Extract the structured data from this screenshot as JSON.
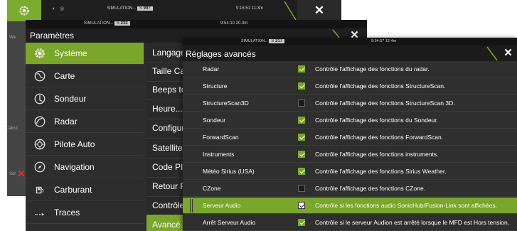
{
  "colors": {
    "accent": "#7aa62b",
    "window": "#2f2f2f",
    "close_x": "#ffffff",
    "alert_x": "#d9322f"
  },
  "window1": {
    "status_sim": "SIMULATION...",
    "status_badge": "S",
    "status_value": "907",
    "status_time": "9:16:51  11.3m",
    "close_label": "✕",
    "left_text_1": "Wa",
    "left_text_2": "Calcul",
    "left_text_3": "Sol",
    "alert_label": "✕"
  },
  "window2": {
    "status_sim": "SIMULATION...",
    "status_badge": "S",
    "status_value": "232",
    "status_time": "9:54:10  20.3m",
    "title": "Paramètres",
    "close_label": "✕",
    "menu": [
      {
        "label": "Système",
        "icon": "gear-icon"
      },
      {
        "label": "Carte",
        "icon": "globe-icon"
      },
      {
        "label": "Sondeur",
        "icon": "sonar-icon"
      },
      {
        "label": "Radar",
        "icon": "radar-icon"
      },
      {
        "label": "Pilote Auto",
        "icon": "autopilot-icon"
      },
      {
        "label": "Navigation",
        "icon": "compass-icon"
      },
      {
        "label": "Carburant",
        "icon": "fuel-icon"
      },
      {
        "label": "Traces",
        "icon": "tracks-icon"
      }
    ],
    "submenu": [
      {
        "label": "Langage"
      },
      {
        "label": "Taille Cara"
      },
      {
        "label": "Beeps tou"
      },
      {
        "label": "Heure..."
      },
      {
        "label": "Configure"
      },
      {
        "label": "Satellites"
      },
      {
        "label": "Code PIN"
      },
      {
        "label": "Retour Ré"
      },
      {
        "label": "Contrôle"
      },
      {
        "label": "Avancé..."
      }
    ]
  },
  "window3": {
    "status_sim": "SIMULATION...",
    "status_badge": "S",
    "status_value": "217",
    "status_time": "9:54:57  12.4m",
    "title": "Réglages avancés",
    "close_label": "✕",
    "rows": [
      {
        "name": "Radar",
        "checked": true,
        "desc": "Contrôle l'affichage des fonctions du radar."
      },
      {
        "name": "Structure",
        "checked": true,
        "desc": "Contrôle l'affichage des fonctions StructureScan."
      },
      {
        "name": "StructureScan3D",
        "checked": false,
        "desc": "Contrôle l'affichage des fonctions StructureScan 3D."
      },
      {
        "name": "Sondeur",
        "checked": true,
        "desc": "Contrôle l'affichage des fonctions du Sondeur."
      },
      {
        "name": "ForwardScan",
        "checked": true,
        "desc": "Contrôle l'affichage des fonctions ForwardScan."
      },
      {
        "name": "Instruments",
        "checked": true,
        "desc": "Contrôle l'affichage des fonctions instruments."
      },
      {
        "name": "Météo Sirius (USA)",
        "checked": true,
        "desc": "Contrôle l'affichage des fonctions Sirius Weather."
      },
      {
        "name": "CZone",
        "checked": false,
        "desc": "Contrôle l'affichage des fonctions CZone."
      },
      {
        "name": "Serveur Audio",
        "checked": true,
        "desc": "Contrôle si les fonctions audio SonicHub/Fusion-Link sont affichées."
      },
      {
        "name": "Arrêt Serveur Audio",
        "checked": true,
        "desc": "Contrôle si le serveur Audion est arrêté lorsque le MFD est  Hors tension."
      }
    ]
  }
}
